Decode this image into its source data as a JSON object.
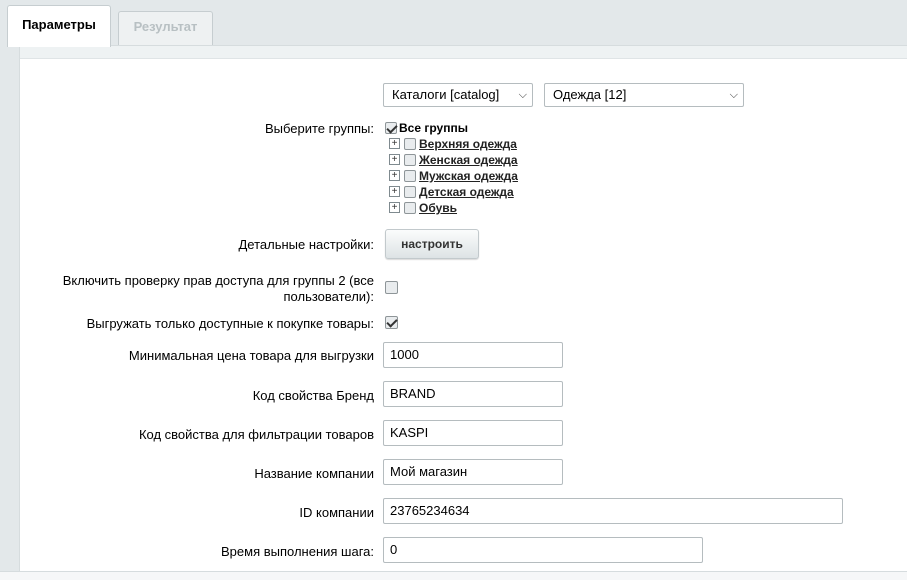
{
  "tabs": [
    {
      "label": "Параметры",
      "active": true
    },
    {
      "label": "Результат",
      "active": false
    }
  ],
  "catalog_select": {
    "value": "Каталоги [catalog]"
  },
  "iblock_select": {
    "value": "Одежда [12]"
  },
  "groups": {
    "label": "Выберите группы:",
    "all_label": "Все группы",
    "all_checked": true,
    "items": [
      {
        "label": "Верхняя одежда",
        "checked": false
      },
      {
        "label": "Женская одежда",
        "checked": false
      },
      {
        "label": "Мужская одежда",
        "checked": false
      },
      {
        "label": "Детская одежда",
        "checked": false
      },
      {
        "label": "Обувь",
        "checked": false
      }
    ]
  },
  "detail": {
    "label": "Детальные настройки:",
    "button": "настроить"
  },
  "access_check": {
    "label_line1": "Включить проверку прав доступа для группы 2 (все",
    "label_line2": "пользователи):",
    "checked": false
  },
  "only_available": {
    "label": "Выгружать только доступные к покупке товары:",
    "checked": true
  },
  "min_price": {
    "label": "Минимальная цена товара для выгрузки",
    "value": "1000"
  },
  "brand_prop": {
    "label": "Код свойства Бренд",
    "value": "BRAND"
  },
  "filter_prop": {
    "label": "Код свойства для фильтрации товаров",
    "value": "KASPI"
  },
  "company_name": {
    "label": "Название компании",
    "value": "Мой магазин"
  },
  "company_id": {
    "label": "ID компании",
    "value": "23765234634"
  },
  "step_time": {
    "label": "Время выполнения шага:",
    "value": "0"
  }
}
